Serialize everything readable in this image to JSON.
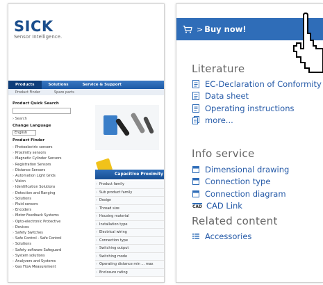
{
  "left_site": {
    "brand": "SICK",
    "tagline": "Sensor Intelligence.",
    "nav_tabs": [
      "Products",
      "Solutions",
      "Service & Support"
    ],
    "sub_tabs": [
      "Product Finder",
      "Spare parts"
    ],
    "quick_search_label": "Product Quick Search",
    "search_link": "› Search",
    "change_language_label": "Change Language",
    "language_value": "English",
    "product_finder_label": "Product Finder",
    "finder_items": [
      "Photoelectric sensors",
      "Proximity sensors",
      "Magnetic Cylinder Sensors",
      "Registration Sensors",
      "Distance Sensors",
      "Automation Light Grids",
      "Vision",
      "Identification Solutions",
      "Detection and Ranging",
      "Solutions",
      "Fluid sensors",
      "Encoders",
      "Motor Feedback Systems",
      "Opto-electronic Protective",
      "Devices",
      "Safety Switches",
      "Safe Control - Safe Control",
      "Solutions",
      "Safety software Safeguard",
      "System solutions",
      "Analyzers and Systems",
      "Gas Flow Measurement"
    ],
    "capacitive_title": "Capacitive Proximity",
    "capacitive_items": [
      "Product family",
      "Sub product family",
      "Design",
      "Thread size",
      "Housing material",
      "Installation type",
      "Electrical wiring",
      "Connection type",
      "Switching output",
      "Switching mode",
      "Operating distance min ... max",
      "Enclosure rating"
    ]
  },
  "buy": {
    "arrow": ">",
    "label": "Buy now!"
  },
  "literature": {
    "heading": "Literature",
    "links": [
      "EC-Declaration of Conformity",
      "Data sheet",
      "Operating instructions",
      "more..."
    ]
  },
  "info_service": {
    "heading": "Info service",
    "links": [
      "Dimensional drawing",
      "Connection type",
      "Connection diagram"
    ],
    "cad_link": "CAD Link",
    "cad_icon_text": "CAD"
  },
  "related_content": {
    "heading": "Related content",
    "links": [
      "Accessories"
    ]
  },
  "colors": {
    "accent": "#2f6db8",
    "link": "#2459a7",
    "heading": "#666666"
  }
}
